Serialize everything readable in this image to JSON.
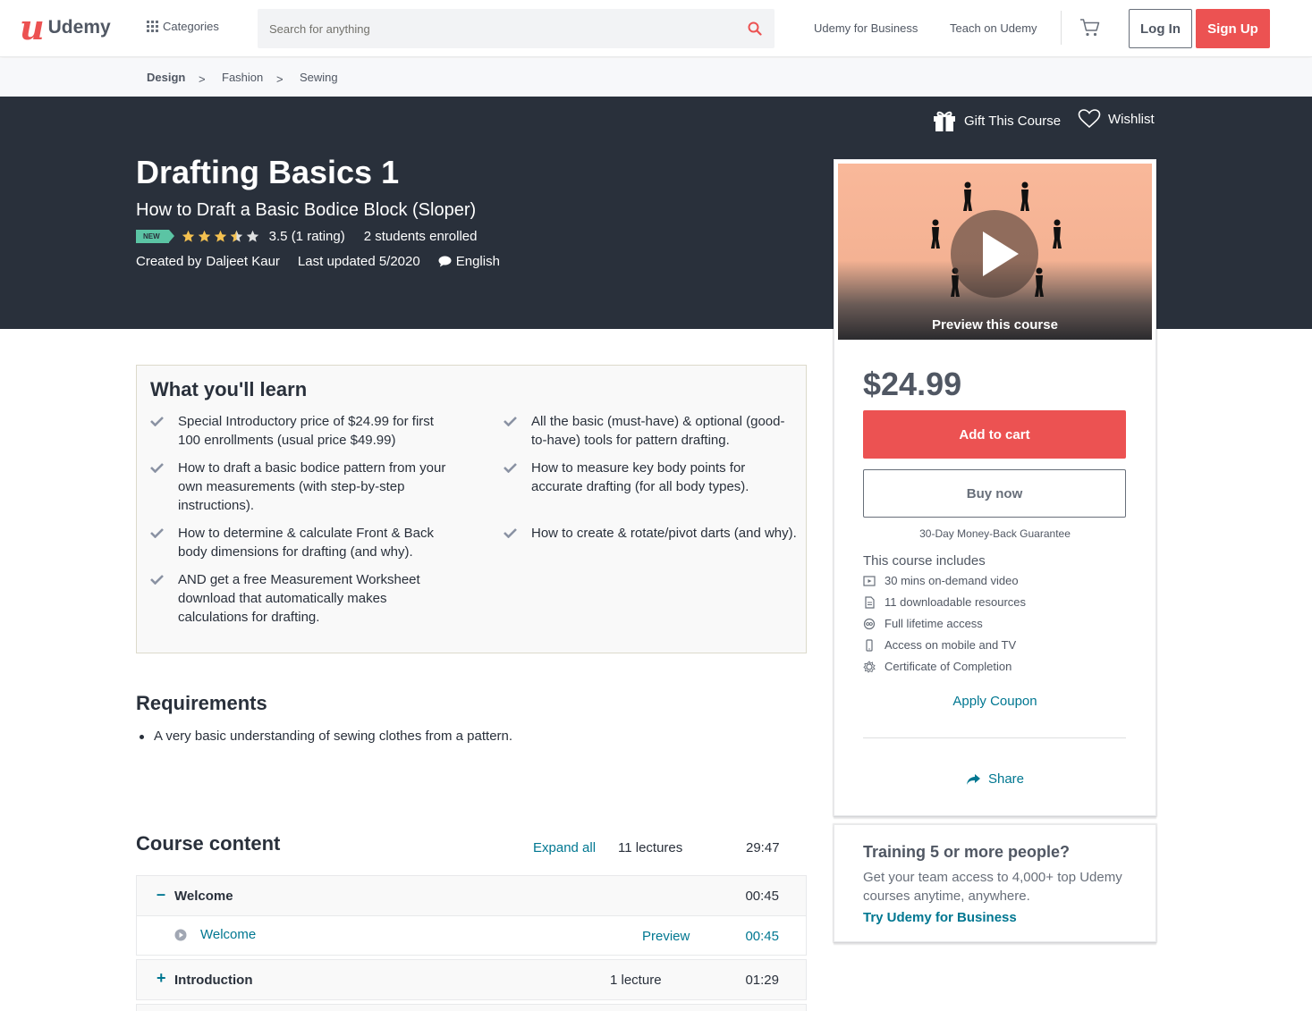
{
  "header": {
    "logo_text": "Udemy",
    "categories_label": "Categories",
    "search_placeholder": "Search for anything",
    "business_link": "Udemy for Business",
    "teach_link": "Teach on Udemy",
    "login_label": "Log In",
    "signup_label": "Sign Up"
  },
  "breadcrumb": [
    "Design",
    "Fashion",
    "Sewing"
  ],
  "breadcrumb_sep": ">",
  "hero": {
    "gift_label": "Gift This Course",
    "wishlist_label": "Wishlist",
    "title": "Drafting Basics 1",
    "subtitle": "How to Draft a Basic Bodice Block (Sloper)",
    "badge": "NEW",
    "rating": "3.5 (1 rating)",
    "rating_value": 3.5,
    "enrolled": "2 students enrolled",
    "created_by": "Created by",
    "author": "Daljeet Kaur",
    "last_updated": "Last updated 5/2020",
    "language": "English"
  },
  "card": {
    "preview_label": "Preview this course",
    "price": "$24.99",
    "add_to_cart": "Add to cart",
    "buy_now": "Buy now",
    "guarantee": "30-Day Money-Back Guarantee",
    "includes_title": "This course includes",
    "includes": [
      {
        "icon": "video-icon",
        "text": "30 mins on-demand video"
      },
      {
        "icon": "file-icon",
        "text": "11 downloadable resources"
      },
      {
        "icon": "infinity-icon",
        "text": "Full lifetime access"
      },
      {
        "icon": "mobile-icon",
        "text": "Access on mobile and TV"
      },
      {
        "icon": "certificate-icon",
        "text": "Certificate of Completion"
      }
    ],
    "apply_coupon": "Apply Coupon",
    "share": "Share"
  },
  "business_card": {
    "title": "Training 5 or more people?",
    "text": "Get your team access to 4,000+ top Udemy courses anytime, anywhere.",
    "link": "Try Udemy for Business"
  },
  "learn": {
    "title": "What you'll learn",
    "items": [
      "Special Introductory price of $24.99 for first 100 enrollments (usual price $49.99)",
      "All the basic (must-have) & optional (good-to-have) tools for pattern drafting.",
      "How to draft a basic bodice pattern from your own measurements (with step-by-step instructions).",
      "How to measure key body points for accurate drafting (for all body types).",
      "How to determine & calculate Front & Back body dimensions for drafting (and why).",
      "How to create & rotate/pivot darts (and why).",
      "AND get a free Measurement Worksheet download that automatically makes calculations for drafting."
    ]
  },
  "requirements": {
    "title": "Requirements",
    "items": [
      "A very basic understanding of sewing clothes from a pattern."
    ]
  },
  "content": {
    "title": "Course content",
    "expand_all": "Expand all",
    "lectures": "11 lectures",
    "total": "29:47",
    "sections": [
      {
        "sign": "–",
        "name": "Welcome",
        "lectures": "",
        "time": "00:45"
      },
      {
        "sign": "+",
        "name": "Introduction",
        "lectures": "1 lecture",
        "time": "01:29"
      }
    ],
    "lecture": {
      "name": "Welcome",
      "preview": "Preview",
      "time": "00:45"
    }
  },
  "colors": {
    "brand": "#ec5252",
    "hero_bg": "#29303b",
    "link": "#007791",
    "star": "#f4c150"
  }
}
